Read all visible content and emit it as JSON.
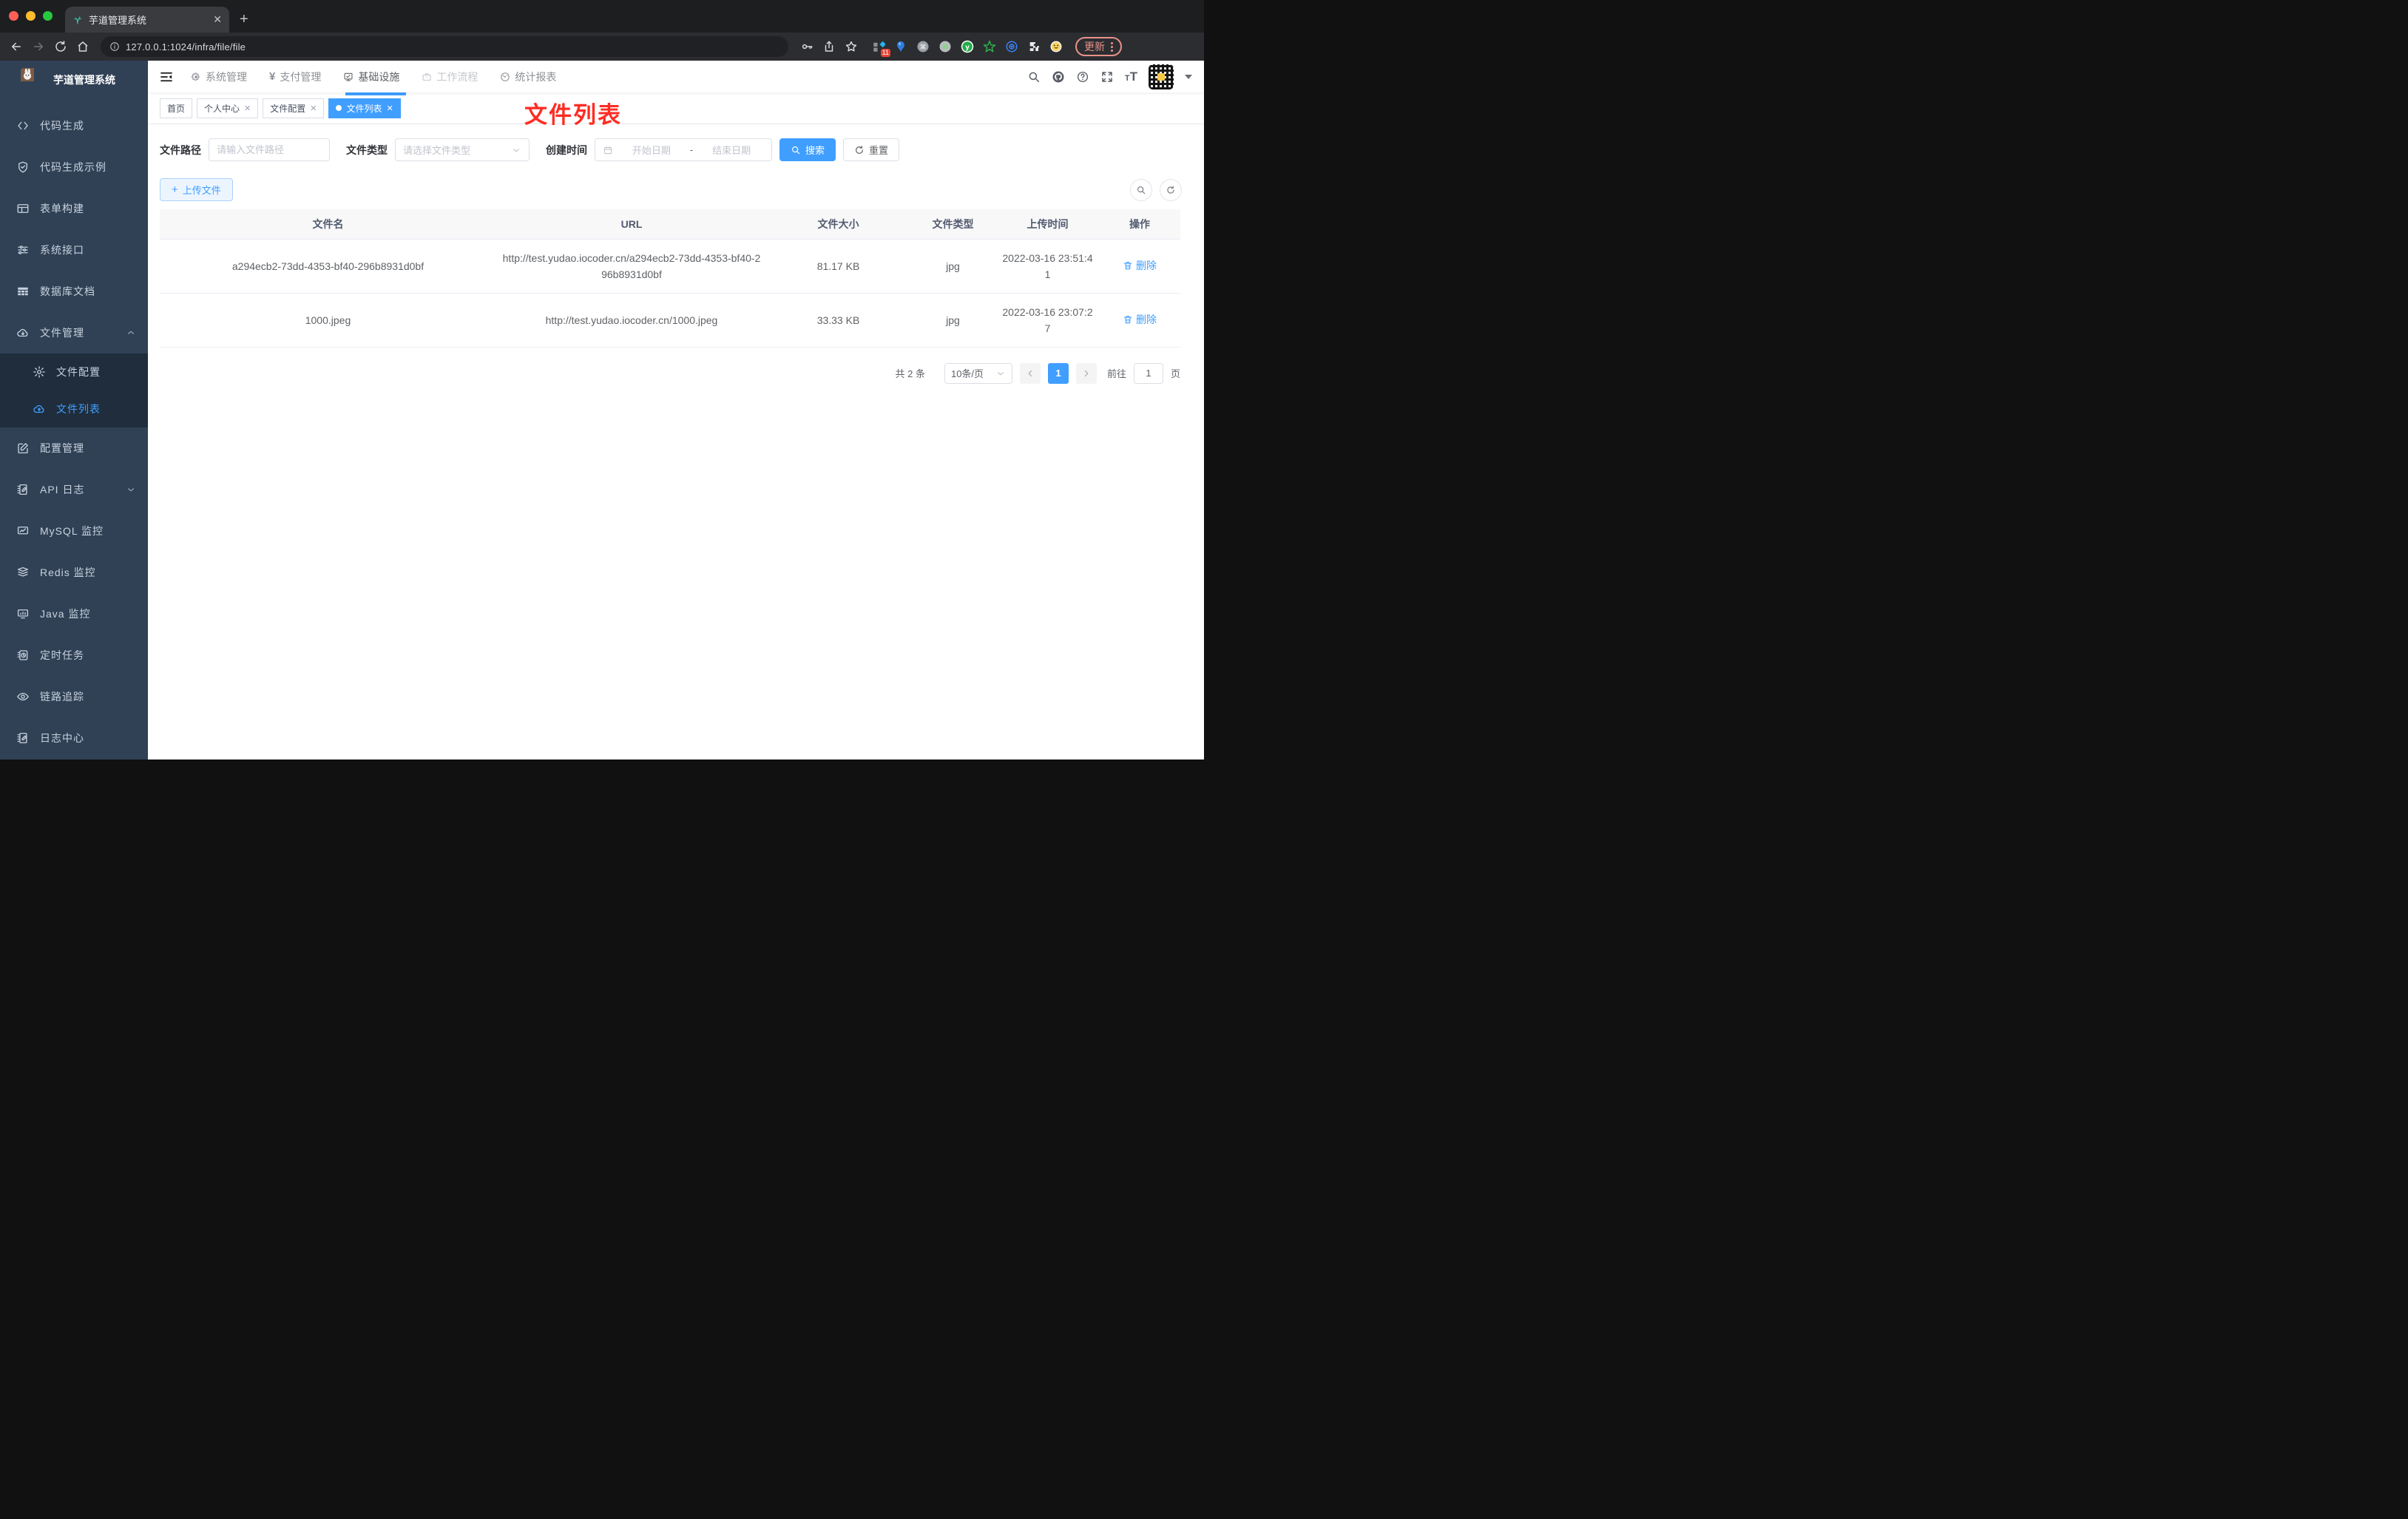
{
  "browser": {
    "tab_title": "芋道管理系统",
    "url": "127.0.0.1:1024/infra/file/file",
    "extension_badge": "11",
    "update_label": "更新"
  },
  "app": {
    "logo_title": "芋道管理系统",
    "navbar": {
      "items": [
        {
          "label": "系统管理",
          "icon": "gear-icon"
        },
        {
          "label": "支付管理",
          "icon": "yen-icon"
        },
        {
          "label": "基础设施",
          "icon": "monitor-check-icon"
        },
        {
          "label": "工作流程",
          "icon": "briefcase-icon"
        },
        {
          "label": "统计报表",
          "icon": "gauge-icon"
        }
      ]
    },
    "sidebar": {
      "items": [
        {
          "label": "代码生成",
          "icon": "code-icon"
        },
        {
          "label": "代码生成示例",
          "icon": "shield-check-icon"
        },
        {
          "label": "表单构建",
          "icon": "form-table-icon"
        },
        {
          "label": "系统接口",
          "icon": "sliders-icon"
        },
        {
          "label": "数据库文档",
          "icon": "db-grid-icon"
        },
        {
          "label": "文件管理",
          "icon": "cloud-download-icon",
          "expanded": true
        },
        {
          "label": "文件配置",
          "icon": "gear-icon",
          "sub": true
        },
        {
          "label": "文件列表",
          "icon": "cloud-upload-icon",
          "sub": true,
          "active": true
        },
        {
          "label": "配置管理",
          "icon": "edit-square-icon"
        },
        {
          "label": "API 日志",
          "icon": "log-edit-icon",
          "collapsed": true
        },
        {
          "label": "MySQL 监控",
          "icon": "chart-monitor-icon"
        },
        {
          "label": "Redis 监控",
          "icon": "stack-icon"
        },
        {
          "label": "Java 监控",
          "icon": "monitor-bars-icon"
        },
        {
          "label": "定时任务",
          "icon": "schedule-icon"
        },
        {
          "label": "链路追踪",
          "icon": "eye-icon"
        },
        {
          "label": "日志中心",
          "icon": "log-edit-icon"
        }
      ]
    },
    "tags": [
      {
        "label": "首页",
        "closable": false
      },
      {
        "label": "个人中心",
        "closable": true
      },
      {
        "label": "文件配置",
        "closable": true
      },
      {
        "label": "文件列表",
        "closable": true,
        "active": true
      }
    ],
    "annotation": {
      "text": "文件列表",
      "color": "#fe2c23"
    },
    "filter": {
      "path_label": "文件路径",
      "path_placeholder": "请输入文件路径",
      "type_label": "文件类型",
      "type_placeholder": "请选择文件类型",
      "date_label": "创建时间",
      "date_start_placeholder": "开始日期",
      "date_separator": "-",
      "date_end_placeholder": "结束日期",
      "search_label": "搜索",
      "reset_label": "重置"
    },
    "toolbar": {
      "upload_label": "上传文件"
    },
    "table": {
      "columns": [
        "文件名",
        "URL",
        "文件大小",
        "文件类型",
        "上传时间",
        "操作"
      ],
      "rows": [
        {
          "name": "a294ecb2-73dd-4353-bf40-296b8931d0bf",
          "url": "http://test.yudao.iocoder.cn/a294ecb2-73dd-4353-bf40-296b8931d0bf",
          "size": "81.17 KB",
          "type": "jpg",
          "time": "2022-03-16 23:51:41",
          "action": "删除"
        },
        {
          "name": "1000.jpeg",
          "url": "http://test.yudao.iocoder.cn/1000.jpeg",
          "size": "33.33 KB",
          "type": "jpg",
          "time": "2022-03-16 23:07:27",
          "action": "删除"
        }
      ]
    },
    "pagination": {
      "total": "共 2 条",
      "page_size": "10条/页",
      "current": "1",
      "goto_label": "前往",
      "goto_value": "1",
      "page_label": "页"
    }
  },
  "colors": {
    "accent": "#409eff",
    "sidebar_bg": "#304156",
    "sidebar_sub_bg": "#1f2d3d",
    "annotation_red": "#fe2c23",
    "update_pill": "#e8928a",
    "table_header_bg": "#f8f8f9"
  }
}
